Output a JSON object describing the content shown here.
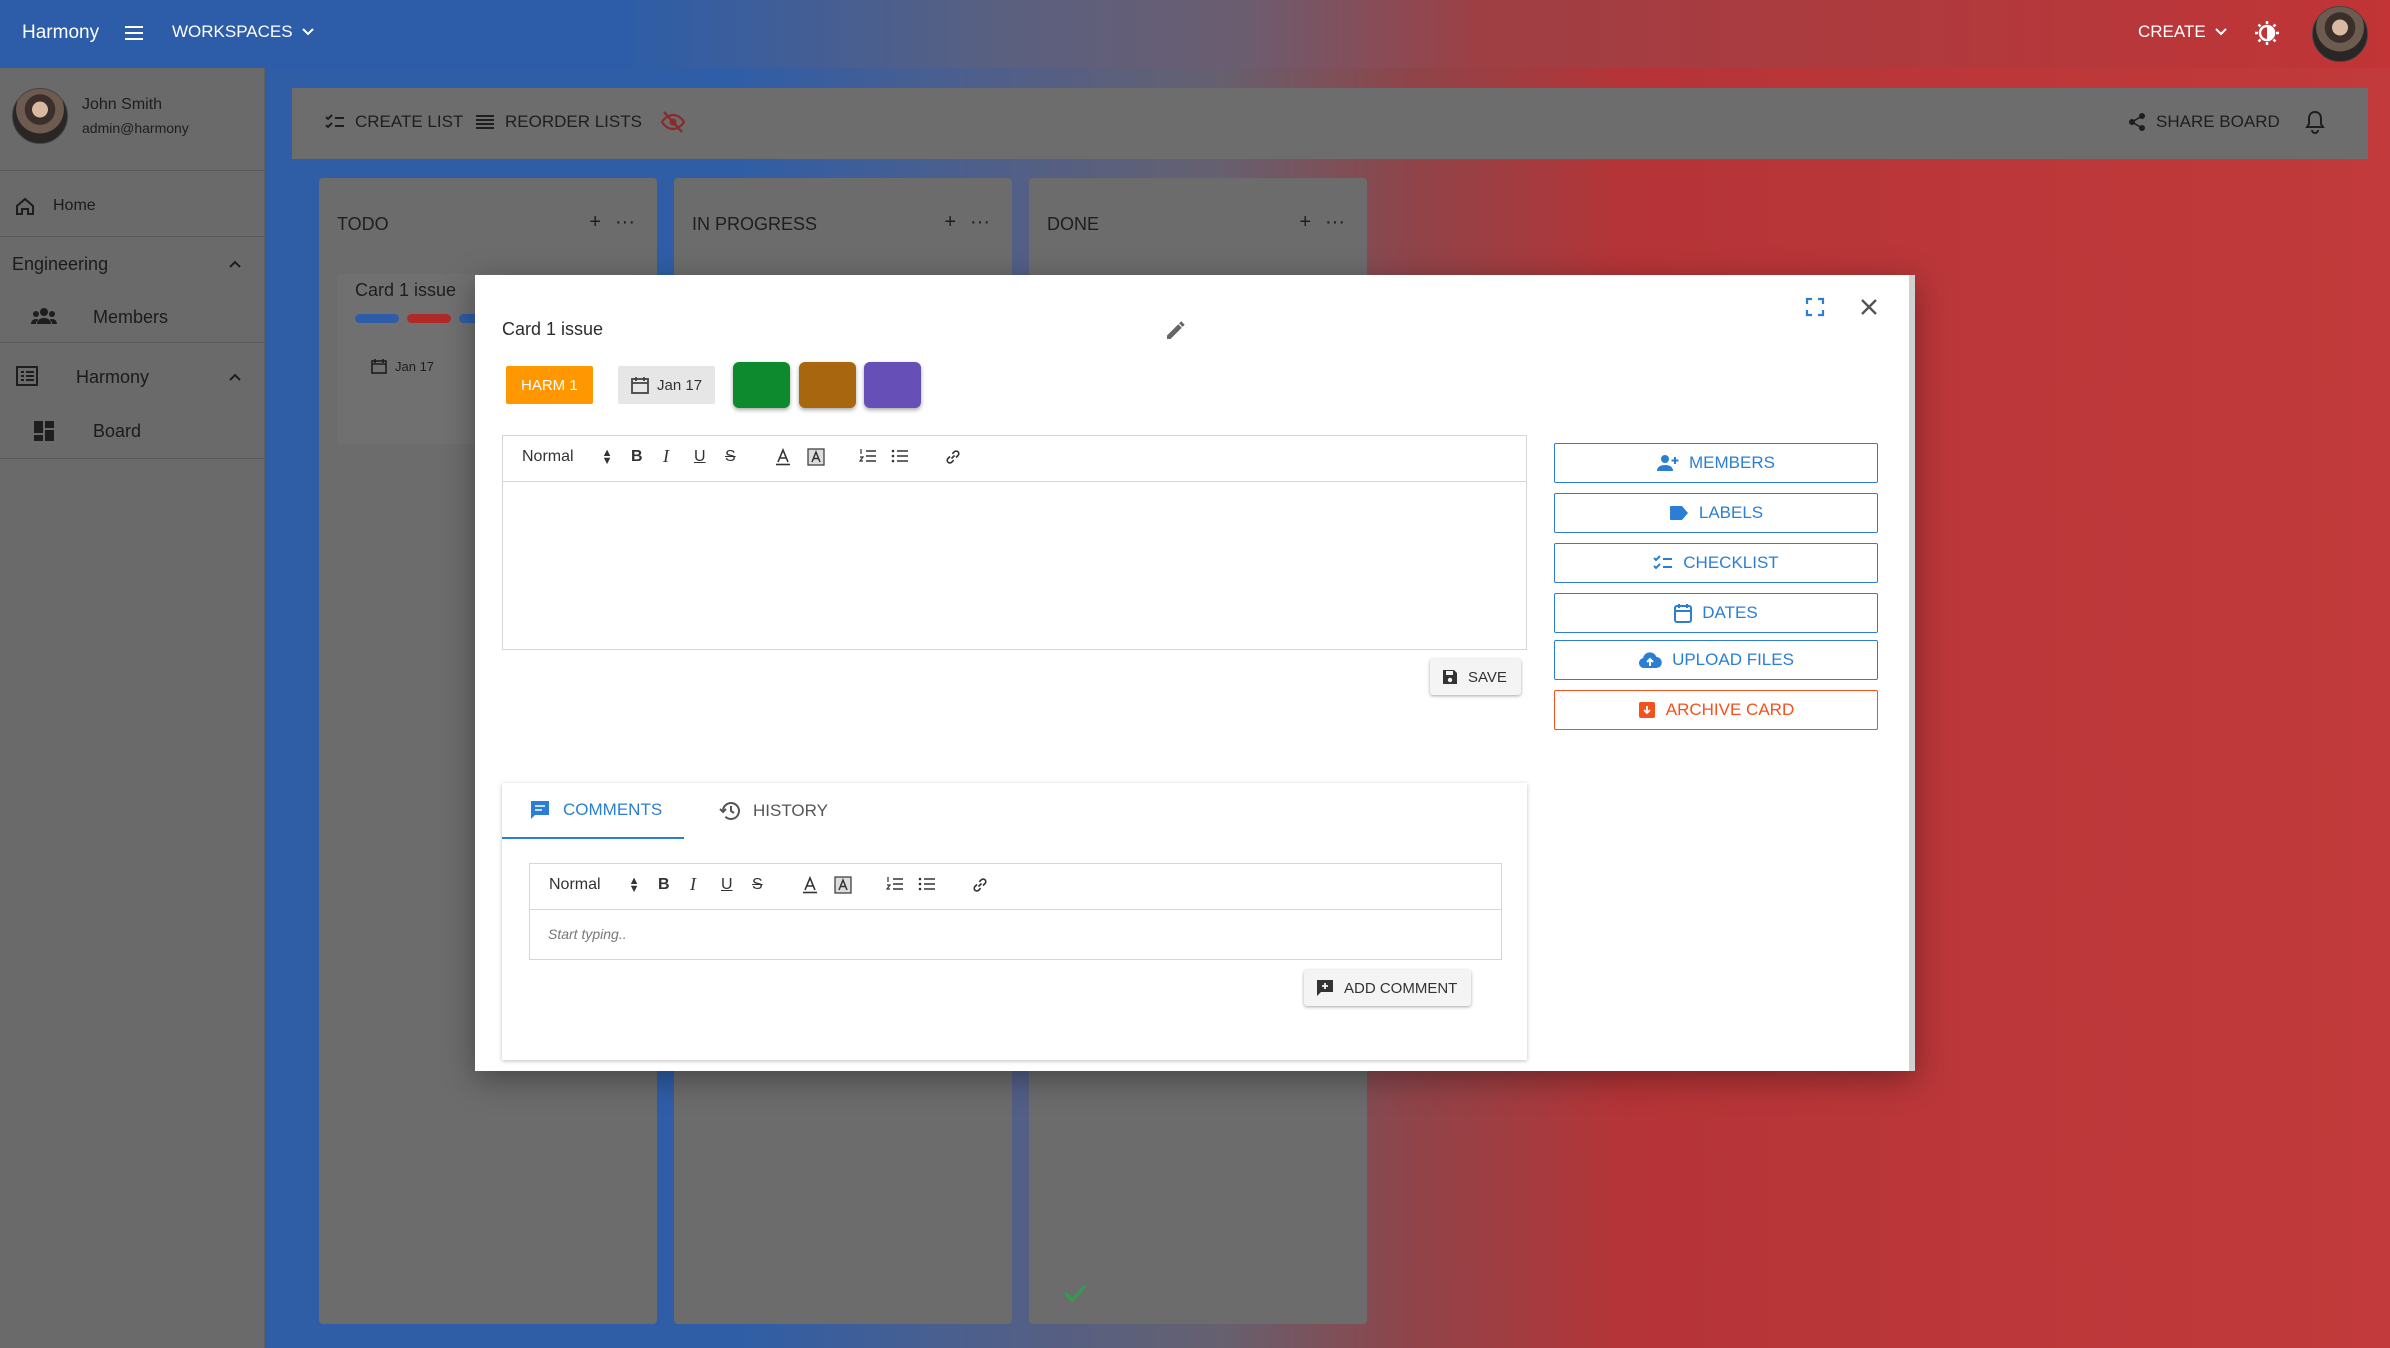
{
  "appbar": {
    "brand": "Harmony",
    "workspaces_label": "WORKSPACES",
    "create_label": "CREATE"
  },
  "drawer": {
    "user_name": "John Smith",
    "user_email": "admin@harmony",
    "home_label": "Home",
    "section_engineering": "Engineering",
    "members_label": "Members",
    "section_harmony": "Harmony",
    "board_label": "Board"
  },
  "boardbar": {
    "create_list": "CREATE LIST",
    "reorder_lists": "REORDER LISTS",
    "share_board": "SHARE BOARD"
  },
  "lists": [
    {
      "title": "TODO"
    },
    {
      "title": "IN PROGRESS"
    },
    {
      "title": "DONE"
    }
  ],
  "background_card": {
    "title": "Card 1 issue",
    "date": "Jan 17",
    "label_colors": [
      "#2d5da8",
      "#b02a2a",
      "#2d5da8"
    ]
  },
  "modal": {
    "card_title": "Card 1 issue",
    "tag_label": "HARM 1",
    "tag_color": "#ff9800",
    "due_date": "Jan 17",
    "label_swatches": [
      "#0e8a2e",
      "#a8670f",
      "#6650b8"
    ],
    "editor": {
      "format": "Normal",
      "save_label": "SAVE"
    },
    "actions": {
      "members": "MEMBERS",
      "labels": "LABELS",
      "checklist": "CHECKLIST",
      "dates": "DATES",
      "upload_files": "UPLOAD FILES",
      "archive_card": "ARCHIVE CARD"
    },
    "tabs": {
      "comments": "COMMENTS",
      "history": "HISTORY"
    },
    "comment_editor": {
      "format": "Normal",
      "placeholder": "Start typing..",
      "add_comment_label": "ADD COMMENT"
    }
  },
  "colors": {
    "accent": "#2a7fd4",
    "danger": "#f4511e",
    "done_check": "#2e9e4f"
  }
}
